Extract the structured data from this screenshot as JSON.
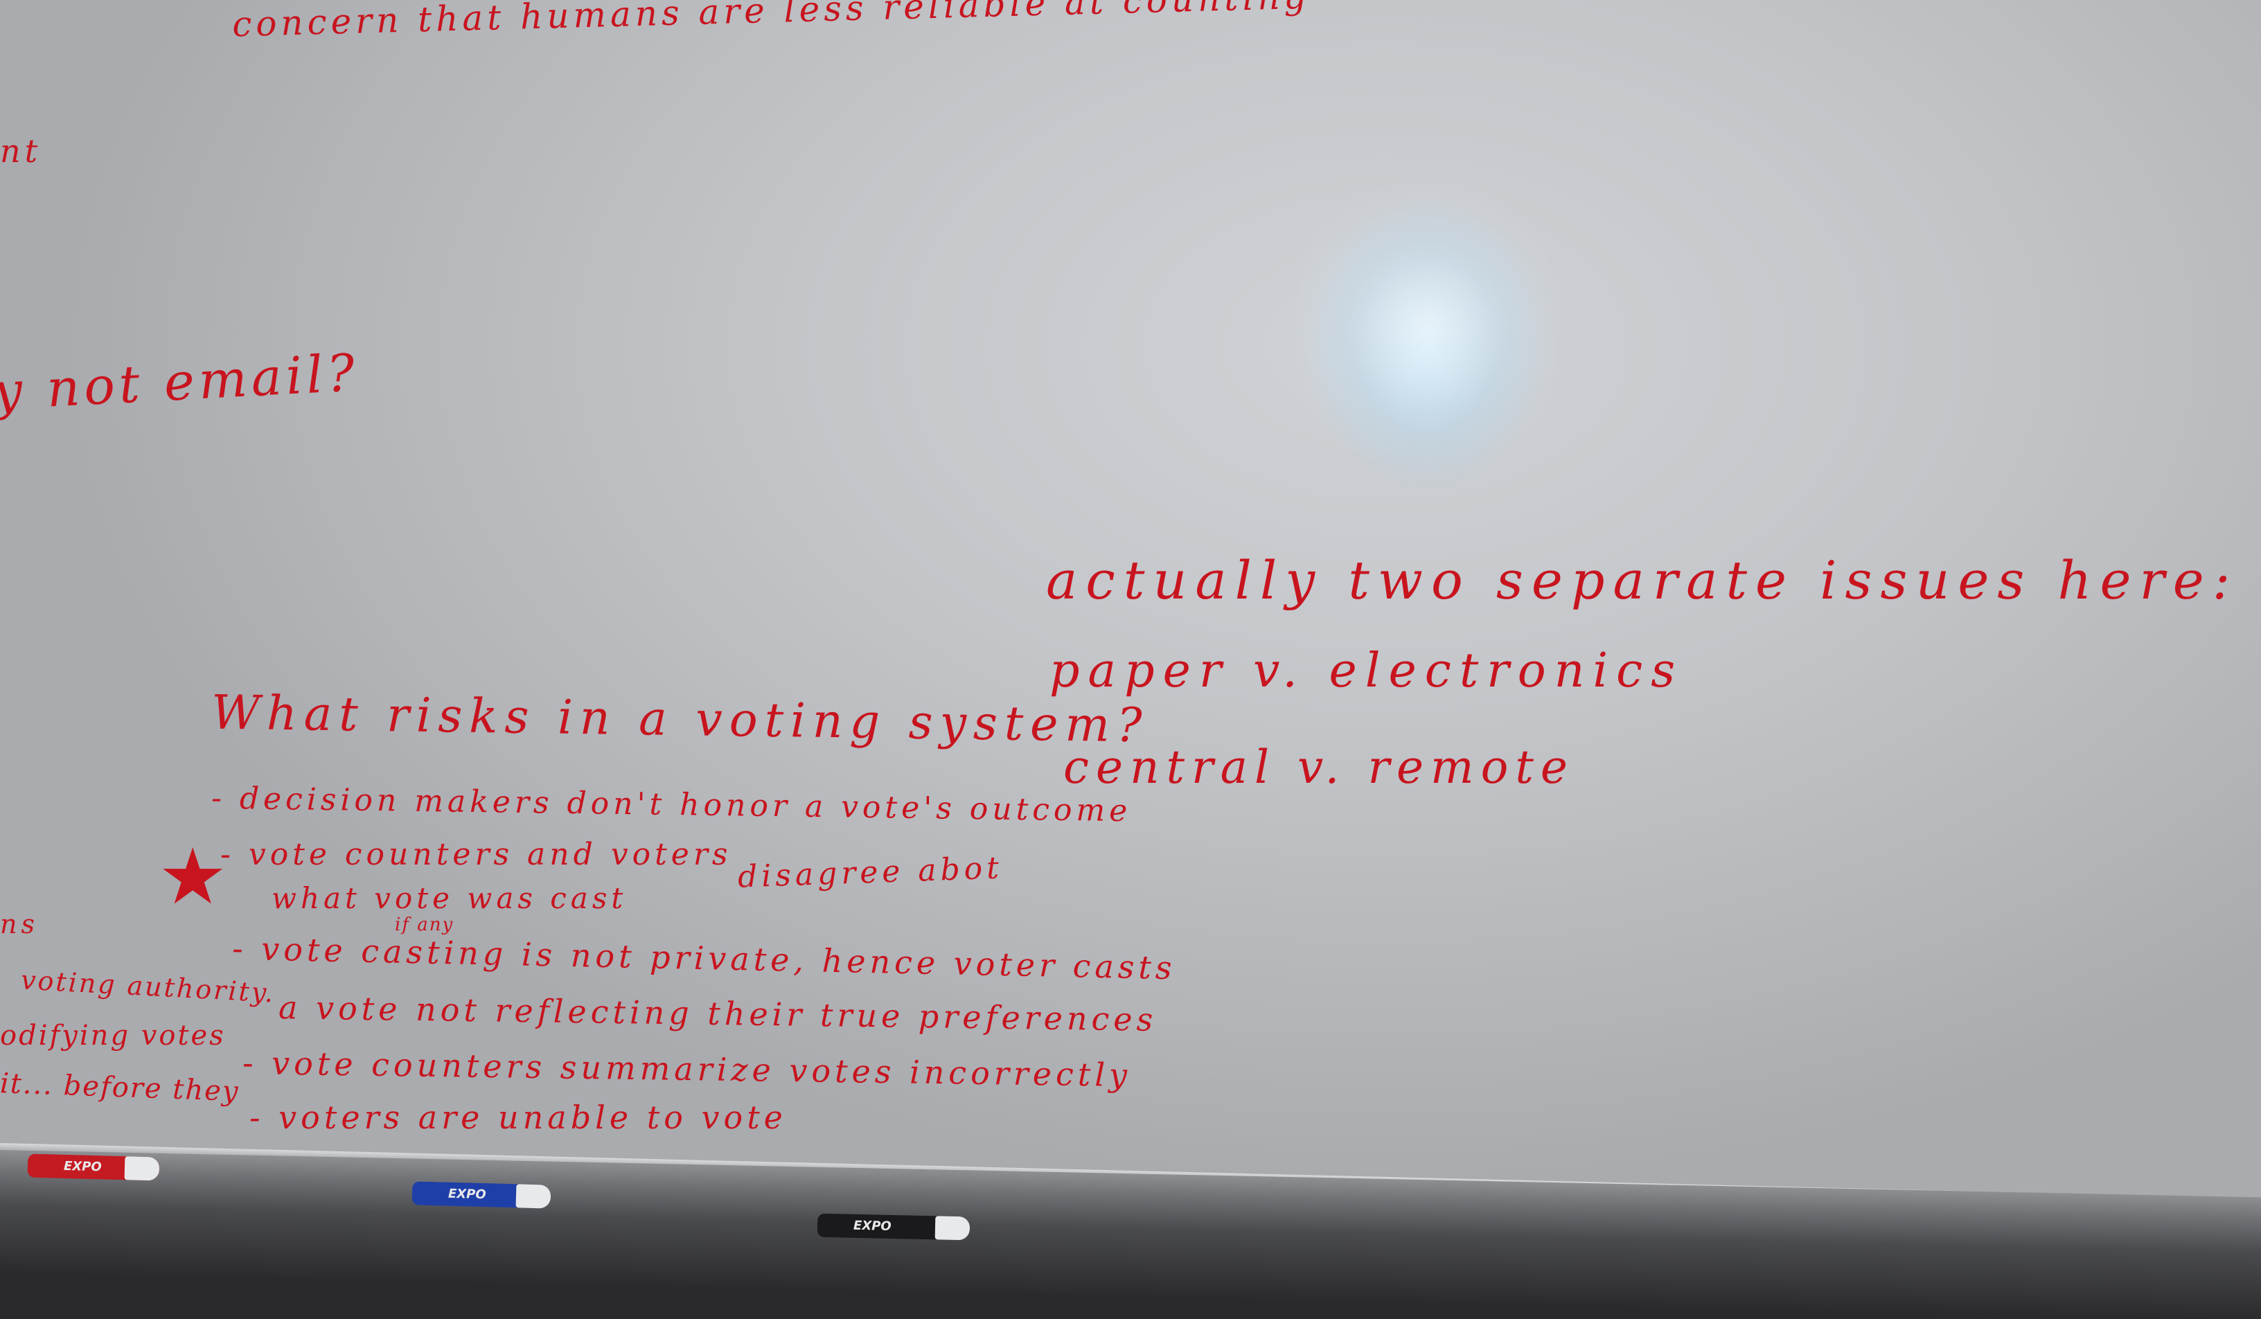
{
  "whiteboard": {
    "top_note": "concern that humans are less reliable at counting",
    "left_fragment_1": "nt",
    "left_question": "y not email?",
    "issues": {
      "heading": "actually two separate issues here:",
      "line1": "paper v. electronics",
      "line2": "central v. remote"
    },
    "risks": {
      "heading": "What risks in a voting system?",
      "item1": "- decision makers don't honor a vote's outcome",
      "item2a": "- vote counters and voters",
      "item2b": "disagree abot",
      "item2c": "what vote was cast",
      "item2_insert": "if any",
      "star": "★",
      "item3a": "- vote casting is not private, hence voter casts",
      "item3b": "a vote not reflecting their true preferences",
      "item4": "- vote counters summarize votes incorrectly",
      "item5": "- voters are unable to vote"
    },
    "left_margin": {
      "frag1": "ns",
      "frag2": "voting authority.",
      "frag3": "odifying votes",
      "frag4": "it... before they"
    }
  },
  "markers": [
    {
      "label": "EXPO",
      "color": "#c41a22"
    },
    {
      "label": "EXPO",
      "color": "#1f3fa8"
    },
    {
      "label": "EXPO",
      "color": "#1a1a1c"
    }
  ],
  "colors": {
    "ink": "#c8141e",
    "board": "#c4c6ca"
  }
}
